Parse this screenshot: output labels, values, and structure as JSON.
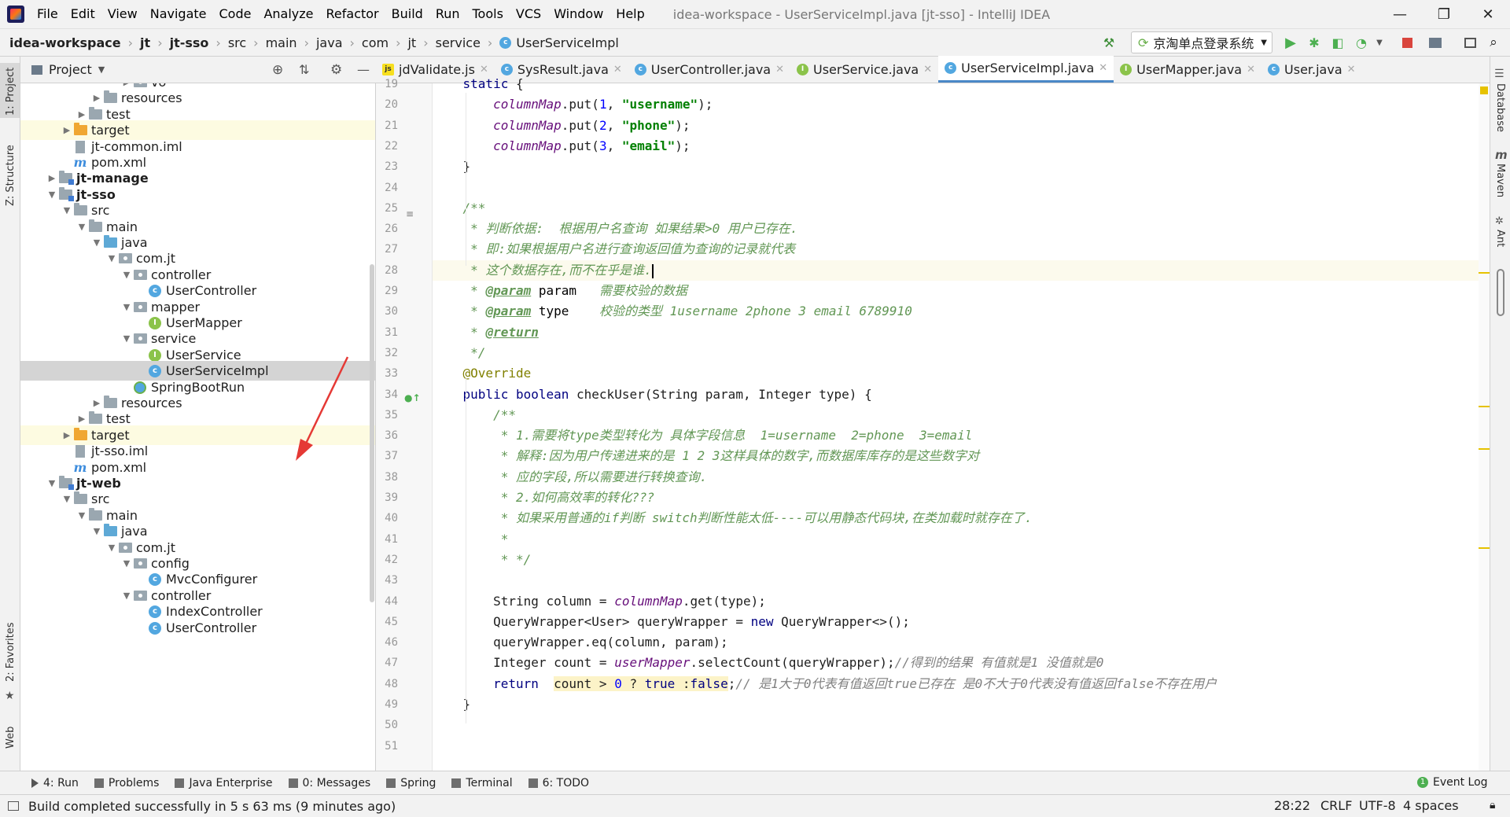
{
  "menubar": {
    "items": [
      "File",
      "Edit",
      "View",
      "Navigate",
      "Code",
      "Analyze",
      "Refactor",
      "Build",
      "Run",
      "Tools",
      "VCS",
      "Window",
      "Help"
    ],
    "title": "idea-workspace - UserServiceImpl.java [jt-sso] - IntelliJ IDEA"
  },
  "navbar": {
    "crumbs": [
      "idea-workspace",
      "jt",
      "jt-sso",
      "src",
      "main",
      "java",
      "com",
      "jt",
      "service",
      "UserServiceImpl"
    ],
    "run_config": "京淘单点登录系统"
  },
  "left_stripe": {
    "project": "1: Project",
    "structure": "Z: Structure",
    "favorites": "2: Favorites",
    "web": "Web"
  },
  "right_stripe": {
    "database": "Database",
    "maven": "Maven",
    "ant": "Ant"
  },
  "project_panel": {
    "title": "Project",
    "tree": [
      {
        "label": "vo",
        "indent": 7,
        "arrow": "▶",
        "icon": "pkg"
      },
      {
        "label": "resources",
        "indent": 5,
        "arrow": "▶",
        "icon": "folder"
      },
      {
        "label": "test",
        "indent": 4,
        "arrow": "▶",
        "icon": "folder"
      },
      {
        "label": "target",
        "indent": 3,
        "arrow": "▶",
        "icon": "folder-orange",
        "row": "yellow"
      },
      {
        "label": "jt-common.iml",
        "indent": 3,
        "arrow": "",
        "icon": "iml"
      },
      {
        "label": "pom.xml",
        "indent": 3,
        "arrow": "",
        "icon": "mvn"
      },
      {
        "label": "jt-manage",
        "indent": 2,
        "arrow": "▶",
        "icon": "module",
        "bold": true
      },
      {
        "label": "jt-sso",
        "indent": 2,
        "arrow": "▼",
        "icon": "module",
        "bold": true
      },
      {
        "label": "src",
        "indent": 3,
        "arrow": "▼",
        "icon": "folder"
      },
      {
        "label": "main",
        "indent": 4,
        "arrow": "▼",
        "icon": "folder"
      },
      {
        "label": "java",
        "indent": 5,
        "arrow": "▼",
        "icon": "folder-src"
      },
      {
        "label": "com.jt",
        "indent": 6,
        "arrow": "▼",
        "icon": "pkg"
      },
      {
        "label": "controller",
        "indent": 7,
        "arrow": "▼",
        "icon": "pkg"
      },
      {
        "label": "UserController",
        "indent": 8,
        "arrow": "",
        "icon": "class"
      },
      {
        "label": "mapper",
        "indent": 7,
        "arrow": "▼",
        "icon": "pkg"
      },
      {
        "label": "UserMapper",
        "indent": 8,
        "arrow": "",
        "icon": "interface"
      },
      {
        "label": "service",
        "indent": 7,
        "arrow": "▼",
        "icon": "pkg"
      },
      {
        "label": "UserService",
        "indent": 8,
        "arrow": "",
        "icon": "interface"
      },
      {
        "label": "UserServiceImpl",
        "indent": 8,
        "arrow": "",
        "icon": "class",
        "row": "selected"
      },
      {
        "label": "SpringBootRun",
        "indent": 7,
        "arrow": "",
        "icon": "spring"
      },
      {
        "label": "resources",
        "indent": 5,
        "arrow": "▶",
        "icon": "folder"
      },
      {
        "label": "test",
        "indent": 4,
        "arrow": "▶",
        "icon": "folder"
      },
      {
        "label": "target",
        "indent": 3,
        "arrow": "▶",
        "icon": "folder-orange",
        "row": "yellow"
      },
      {
        "label": "jt-sso.iml",
        "indent": 3,
        "arrow": "",
        "icon": "iml"
      },
      {
        "label": "pom.xml",
        "indent": 3,
        "arrow": "",
        "icon": "mvn"
      },
      {
        "label": "jt-web",
        "indent": 2,
        "arrow": "▼",
        "icon": "module",
        "bold": true
      },
      {
        "label": "src",
        "indent": 3,
        "arrow": "▼",
        "icon": "folder"
      },
      {
        "label": "main",
        "indent": 4,
        "arrow": "▼",
        "icon": "folder"
      },
      {
        "label": "java",
        "indent": 5,
        "arrow": "▼",
        "icon": "folder-src"
      },
      {
        "label": "com.jt",
        "indent": 6,
        "arrow": "▼",
        "icon": "pkg"
      },
      {
        "label": "config",
        "indent": 7,
        "arrow": "▼",
        "icon": "pkg"
      },
      {
        "label": "MvcConfigurer",
        "indent": 8,
        "arrow": "",
        "icon": "class"
      },
      {
        "label": "controller",
        "indent": 7,
        "arrow": "▼",
        "icon": "pkg"
      },
      {
        "label": "IndexController",
        "indent": 8,
        "arrow": "",
        "icon": "class"
      },
      {
        "label": "UserController",
        "indent": 8,
        "arrow": "",
        "icon": "class"
      }
    ]
  },
  "editor_tabs": [
    {
      "label": "jdValidate.js",
      "icon": "js",
      "active": false
    },
    {
      "label": "SysResult.java",
      "icon": "c",
      "active": false
    },
    {
      "label": "UserController.java",
      "icon": "c",
      "active": false
    },
    {
      "label": "UserService.java",
      "icon": "i",
      "active": false
    },
    {
      "label": "UserServiceImpl.java",
      "icon": "c",
      "active": true
    },
    {
      "label": "UserMapper.java",
      "icon": "i",
      "active": false
    },
    {
      "label": "User.java",
      "icon": "c",
      "active": false
    }
  ],
  "code": {
    "caret_line": 28,
    "lines": [
      {
        "n": "19",
        "tokens": [
          [
            "    ",
            ""
          ],
          [
            "static",
            "kw"
          ],
          [
            " {",
            ""
          ]
        ]
      },
      {
        "n": "20",
        "tokens": [
          [
            "        ",
            ""
          ],
          [
            "columnMap",
            "fld"
          ],
          [
            ".put(",
            ""
          ],
          [
            "1",
            "num"
          ],
          [
            ", ",
            ""
          ],
          [
            "\"username\"",
            "str"
          ],
          [
            ");",
            ""
          ]
        ]
      },
      {
        "n": "21",
        "tokens": [
          [
            "        ",
            ""
          ],
          [
            "columnMap",
            "fld"
          ],
          [
            ".put(",
            ""
          ],
          [
            "2",
            "num"
          ],
          [
            ", ",
            ""
          ],
          [
            "\"phone\"",
            "str"
          ],
          [
            ");",
            ""
          ]
        ]
      },
      {
        "n": "22",
        "tokens": [
          [
            "        ",
            ""
          ],
          [
            "columnMap",
            "fld"
          ],
          [
            ".put(",
            ""
          ],
          [
            "3",
            "num"
          ],
          [
            ", ",
            ""
          ],
          [
            "\"email\"",
            "str"
          ],
          [
            ");",
            ""
          ]
        ]
      },
      {
        "n": "23",
        "tokens": [
          [
            "    }",
            ""
          ]
        ]
      },
      {
        "n": "24",
        "tokens": [
          [
            "",
            ""
          ]
        ]
      },
      {
        "n": "25",
        "tokens": [
          [
            "    ",
            ""
          ],
          [
            "/**",
            "doc"
          ]
        ]
      },
      {
        "n": "26",
        "tokens": [
          [
            "     ",
            ""
          ],
          [
            "* 判断依据:  根据用户名查询 如果结果>0 用户已存在.",
            "doc"
          ]
        ]
      },
      {
        "n": "27",
        "tokens": [
          [
            "     ",
            ""
          ],
          [
            "* 即:如果根据用户名进行查询返回值为查询的记录就代表",
            "doc"
          ]
        ]
      },
      {
        "n": "28",
        "tokens": [
          [
            "     ",
            ""
          ],
          [
            "* 这个数据存在,而不在乎是谁.",
            "doc"
          ]
        ]
      },
      {
        "n": "29",
        "tokens": [
          [
            "     ",
            ""
          ],
          [
            "* ",
            "doc"
          ],
          [
            "@param",
            "doctag"
          ],
          [
            " param",
            "ident"
          ],
          [
            "   需要校验的数据",
            "doc"
          ]
        ]
      },
      {
        "n": "30",
        "tokens": [
          [
            "     ",
            ""
          ],
          [
            "* ",
            "doc"
          ],
          [
            "@param",
            "doctag"
          ],
          [
            " type",
            "ident"
          ],
          [
            "    校验的类型 1username 2phone 3 email 6789910",
            "doc"
          ]
        ]
      },
      {
        "n": "31",
        "tokens": [
          [
            "     ",
            ""
          ],
          [
            "* ",
            "doc"
          ],
          [
            "@return",
            "doctag"
          ]
        ]
      },
      {
        "n": "32",
        "tokens": [
          [
            "     ",
            ""
          ],
          [
            "*/",
            "doc"
          ]
        ]
      },
      {
        "n": "33",
        "tokens": [
          [
            "    ",
            ""
          ],
          [
            "@Override",
            "ann"
          ]
        ]
      },
      {
        "n": "34",
        "tokens": [
          [
            "    ",
            ""
          ],
          [
            "public boolean",
            "kw"
          ],
          [
            " checkUser(String param, Integer type) {",
            ""
          ]
        ]
      },
      {
        "n": "35",
        "tokens": [
          [
            "        ",
            ""
          ],
          [
            "/**",
            "doc"
          ]
        ]
      },
      {
        "n": "36",
        "tokens": [
          [
            "         ",
            ""
          ],
          [
            "* 1.需要将type类型转化为 具体字段信息  1=username  2=phone  3=email",
            "doc"
          ]
        ]
      },
      {
        "n": "37",
        "tokens": [
          [
            "         ",
            ""
          ],
          [
            "* 解释:因为用户传递进来的是 1 2 3这样具体的数字,而数据库库存的是这些数字对",
            "doc"
          ]
        ]
      },
      {
        "n": "38",
        "tokens": [
          [
            "         ",
            ""
          ],
          [
            "* 应的字段,所以需要进行转换查询.",
            "doc"
          ]
        ]
      },
      {
        "n": "39",
        "tokens": [
          [
            "         ",
            ""
          ],
          [
            "* 2.如何高效率的转化???",
            "doc"
          ]
        ]
      },
      {
        "n": "40",
        "tokens": [
          [
            "         ",
            ""
          ],
          [
            "* 如果采用普通的if判断 switch判断性能太低----可以用静态代码块,在类加载时就存在了.",
            "doc"
          ]
        ]
      },
      {
        "n": "41",
        "tokens": [
          [
            "         ",
            ""
          ],
          [
            "*",
            "doc"
          ]
        ]
      },
      {
        "n": "42",
        "tokens": [
          [
            "         ",
            ""
          ],
          [
            "* */",
            "doc"
          ]
        ]
      },
      {
        "n": "43",
        "tokens": [
          [
            "",
            ""
          ]
        ]
      },
      {
        "n": "44",
        "tokens": [
          [
            "        String column = ",
            ""
          ],
          [
            "columnMap",
            "fld"
          ],
          [
            ".get(type);",
            ""
          ]
        ]
      },
      {
        "n": "45",
        "tokens": [
          [
            "        QueryWrapper<User> queryWrapper = ",
            ""
          ],
          [
            "new",
            "kw"
          ],
          [
            " QueryWrapper<>();",
            ""
          ]
        ]
      },
      {
        "n": "46",
        "tokens": [
          [
            "        queryWrapper.eq(column, param);",
            ""
          ]
        ]
      },
      {
        "n": "47",
        "tokens": [
          [
            "        Integer count = ",
            ""
          ],
          [
            "userMapper",
            "fld"
          ],
          [
            ".selectCount(queryWrapper);",
            ""
          ],
          [
            "//得到的结果 有值就是1 没值就是0",
            "cmt"
          ]
        ]
      },
      {
        "n": "48",
        "tokens": [
          [
            "        ",
            ""
          ],
          [
            "return",
            "kw"
          ],
          [
            "  ",
            ""
          ],
          [
            "count > ",
            "hl"
          ],
          [
            "0",
            "num hl"
          ],
          [
            " ? ",
            "hl"
          ],
          [
            "true",
            "kw hl"
          ],
          [
            " :",
            "hl"
          ],
          [
            "false",
            "kw hl"
          ],
          [
            ";",
            ""
          ],
          [
            "// 是1大于0代表有值返回true已存在 是0不大于0代表没有值返回false不存在用户",
            "cmt"
          ]
        ]
      },
      {
        "n": "49",
        "tokens": [
          [
            "    }",
            ""
          ]
        ]
      },
      {
        "n": "50",
        "tokens": [
          [
            "",
            ""
          ]
        ]
      },
      {
        "n": "51",
        "tokens": [
          [
            "",
            ""
          ]
        ]
      }
    ]
  },
  "bottom_tools": [
    {
      "label": "4: Run"
    },
    {
      "label": "Problems"
    },
    {
      "label": "Java Enterprise"
    },
    {
      "label": "0: Messages"
    },
    {
      "label": "Spring"
    },
    {
      "label": "Terminal"
    },
    {
      "label": "6: TODO"
    }
  ],
  "event_log": "Event Log",
  "status": {
    "message": "Build completed successfully in 5 s 63 ms (9 minutes ago)",
    "position": "28:22",
    "line_sep": "CRLF",
    "encoding": "UTF-8",
    "indent": "4 spaces"
  },
  "colors": {
    "accent": "#4a88c7",
    "annotation_arrow": "#e53935"
  }
}
